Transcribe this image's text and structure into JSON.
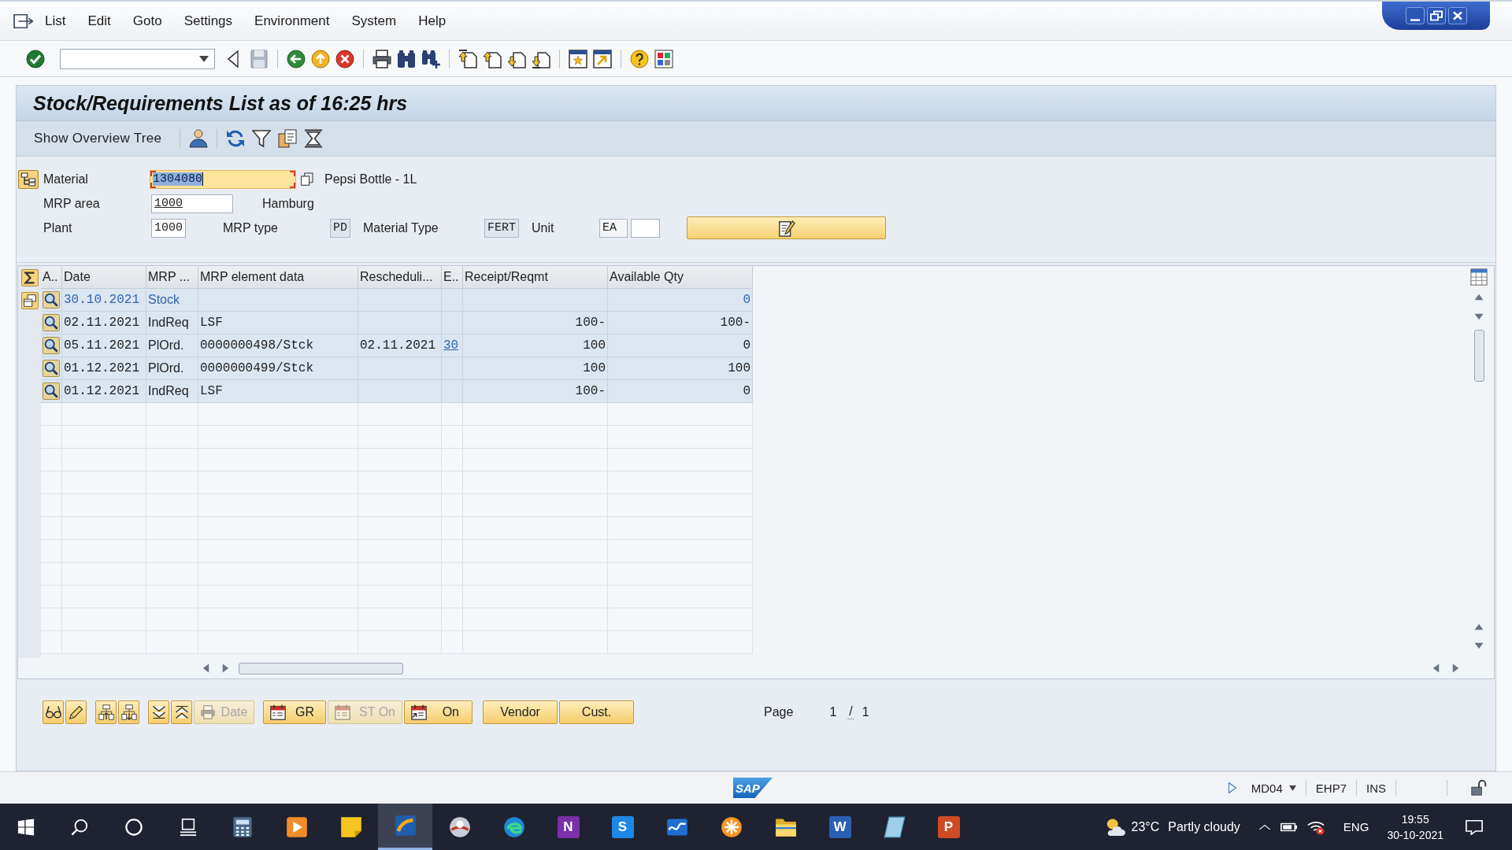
{
  "menu_bar": {
    "items": [
      "List",
      "Edit",
      "Goto",
      "Settings",
      "Environment",
      "System",
      "Help"
    ]
  },
  "title": "Stock/Requirements List as of 16:25 hrs",
  "app_toolbar": {
    "button": "Show Overview Tree"
  },
  "header": {
    "material": {
      "label": "Material",
      "value": "1304080",
      "focused": true,
      "description": "Pepsi Bottle - 1L"
    },
    "mrp_area": {
      "label": "MRP area",
      "value": "1000",
      "description": "Hamburg"
    },
    "plant": {
      "label": "Plant",
      "value": "1000"
    },
    "mrp_type": {
      "label": "MRP type",
      "value": "PD"
    },
    "material_type": {
      "label": "Material Type",
      "value": "FERT"
    },
    "unit": {
      "label": "Unit",
      "value": "EA"
    }
  },
  "table": {
    "columns": [
      "A..",
      "Date",
      "MRP ...",
      "MRP element data",
      "Rescheduli...",
      "E..",
      "Receipt/Reqmt",
      "Available Qty"
    ],
    "rows": [
      {
        "kind": "stock",
        "date": "30.10.2021",
        "mrp_element": "Stock",
        "available_qty": "0"
      },
      {
        "kind": "element",
        "date": "02.11.2021",
        "mrp_element": "IndReq",
        "element_data": "LSF",
        "receipt_reqmt": "100-",
        "available_qty": "100-"
      },
      {
        "kind": "element",
        "date": "05.11.2021",
        "mrp_element": "PlOrd.",
        "element_data": "0000000498/Stck",
        "rescheduling": "02.11.2021",
        "exception": "30",
        "receipt_reqmt": "100",
        "available_qty": "0"
      },
      {
        "kind": "element",
        "date": "01.12.2021",
        "mrp_element": "PlOrd.",
        "element_data": "0000000499/Stck",
        "receipt_reqmt": "100",
        "available_qty": "100"
      },
      {
        "kind": "element",
        "date": "01.12.2021",
        "mrp_element": "IndReq",
        "element_data": "LSF",
        "receipt_reqmt": "100-",
        "available_qty": "0"
      }
    ]
  },
  "list_toolbar": {
    "groups": [
      [
        {
          "kind": "printer",
          "label": "Date",
          "disabled": true
        }
      ],
      [
        {
          "kind": "calendar",
          "label": "GR",
          "disabled": false
        },
        {
          "kind": "calendar",
          "label": "ST On",
          "disabled": true
        },
        {
          "kind": "schedule",
          "label": "On",
          "disabled": false
        }
      ],
      [
        {
          "kind": "text",
          "label": "Vendor",
          "disabled": false
        },
        {
          "kind": "text",
          "label": "Cust.",
          "disabled": false
        }
      ]
    ],
    "pager": {
      "label": "Page",
      "current": "1",
      "separator": "/",
      "total": "1"
    }
  },
  "status_bar": {
    "logo": "SAP",
    "transaction": "MD04",
    "system": "EHP7",
    "mode": "INS"
  },
  "taskbar": {
    "apps": [
      {
        "kind": "calculator",
        "selected": false
      },
      {
        "kind": "media",
        "selected": false
      },
      {
        "kind": "notes",
        "selected": false
      },
      {
        "kind": "logon",
        "selected": true
      },
      {
        "kind": "disc",
        "selected": false
      },
      {
        "kind": "browser",
        "selected": false
      },
      {
        "kind": "letter",
        "label": "N",
        "color": "#7b2fa8",
        "selected": false
      },
      {
        "kind": "letter",
        "label": "S",
        "color": "#1e88e5",
        "selected": false
      },
      {
        "kind": "wave",
        "selected": false
      },
      {
        "kind": "flower",
        "selected": false
      },
      {
        "kind": "folder",
        "selected": false
      },
      {
        "kind": "letter",
        "label": "W",
        "color": "#2b5fb4",
        "selected": false
      },
      {
        "kind": "slate",
        "selected": false
      },
      {
        "kind": "letter",
        "label": "P",
        "color": "#d04a26",
        "selected": false
      }
    ],
    "weather": {
      "temperature": "23°C",
      "condition": "Partly cloudy"
    },
    "language": "ENG",
    "time": "19:55",
    "date": "30-10-2021"
  }
}
